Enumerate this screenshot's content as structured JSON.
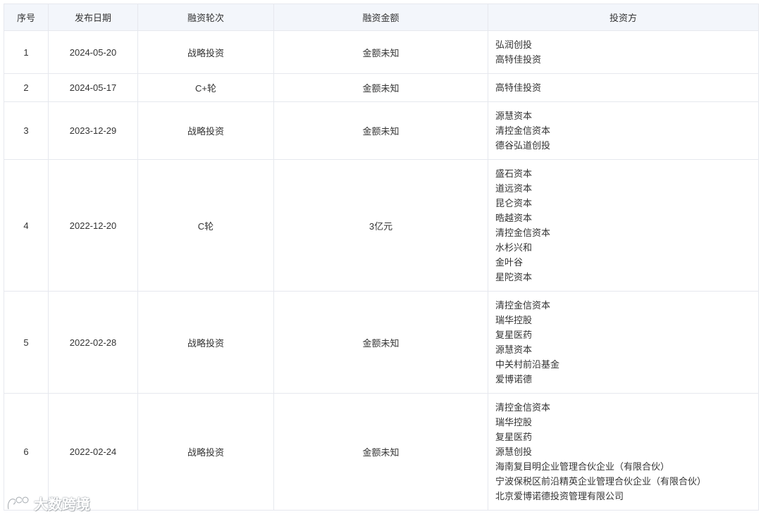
{
  "table": {
    "headers": [
      "序号",
      "发布日期",
      "融资轮次",
      "融资金额",
      "投资方"
    ],
    "rows": [
      {
        "no": "1",
        "date": "2024-05-20",
        "round": "战略投资",
        "amount": "金额未知",
        "investors": [
          "弘润创投",
          "高特佳投资"
        ]
      },
      {
        "no": "2",
        "date": "2024-05-17",
        "round": "C+轮",
        "amount": "金额未知",
        "investors": [
          "高特佳投资"
        ]
      },
      {
        "no": "3",
        "date": "2023-12-29",
        "round": "战略投资",
        "amount": "金额未知",
        "investors": [
          "源慧资本",
          "清控金信资本",
          "德谷弘道创投"
        ]
      },
      {
        "no": "4",
        "date": "2022-12-20",
        "round": "C轮",
        "amount": "3亿元",
        "investors": [
          "盛石资本",
          "道远资本",
          "昆仑资本",
          "晧越资本",
          "清控金信资本",
          "水杉兴和",
          "金叶谷",
          "星陀资本"
        ]
      },
      {
        "no": "5",
        "date": "2022-02-28",
        "round": "战略投资",
        "amount": "金额未知",
        "investors": [
          "清控金信资本",
          "瑞华控股",
          "复星医药",
          "源慧资本",
          "中关村前沿基金",
          "爱博诺德"
        ]
      },
      {
        "no": "6",
        "date": "2022-02-24",
        "round": "战略投资",
        "amount": "金额未知",
        "investors": [
          "清控金信资本",
          "瑞华控股",
          "复星医药",
          "源慧创投",
          "海南复目明企业管理合伙企业（有限合伙）",
          "宁波保税区前沿精英企业管理合伙企业（有限合伙）",
          "北京爱博诺德投资管理有限公司"
        ]
      }
    ]
  },
  "watermark": {
    "text": "大数跨境",
    "icon": "brand-logo-icon"
  }
}
